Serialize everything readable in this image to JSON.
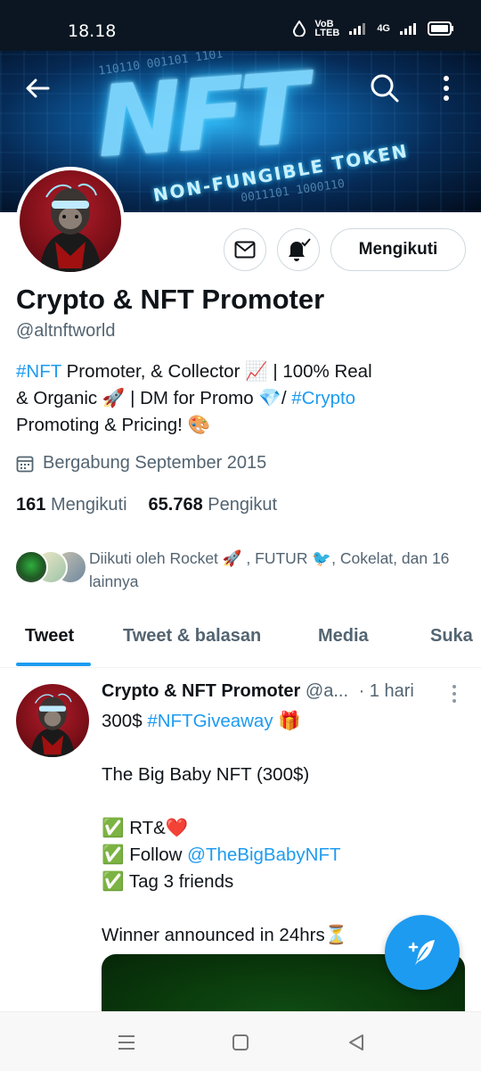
{
  "status_bar": {
    "time": "18.18",
    "network_label_top": "VoB",
    "network_label_bottom": "LTEB",
    "signal_label": "4G",
    "icons": [
      "water-drop-icon",
      "signal-icon",
      "battery-icon"
    ]
  },
  "header": {
    "banner_text": "NFT",
    "banner_subtext": "NON-FUNGIBLE TOKEN",
    "banner_binary_top": "110110 001101 1101",
    "banner_binary_bottom": "0011101 1000110",
    "back_icon": "back-arrow-icon",
    "search_icon": "search-icon",
    "more_icon": "more-vertical-icon"
  },
  "profile": {
    "name": "Crypto & NFT Promoter",
    "handle": "@altnftworld",
    "follow_button_label": "Mengikuti",
    "bio": {
      "line1_tag": "#NFT",
      "line1_text": " Promoter, & Collector 📈 | 100% Real",
      "line2_text": "& Organic 🚀 | DM for Promo 💎/ ",
      "line2_tag": "#Crypto",
      "line3_text": "Promoting & Pricing! 🎨"
    },
    "joined": "Bergabung September 2015",
    "following_count": "161",
    "following_label": "Mengikuti",
    "followers_count": "65.768",
    "followers_label": "Pengikut",
    "followed_by": "Diikuti oleh Rocket 🚀 , FUTUR 🐦, Cokelat, dan 16 lainnya"
  },
  "tabs": [
    {
      "label": "Tweet"
    },
    {
      "label": "Tweet & balasan"
    },
    {
      "label": "Media"
    },
    {
      "label": "Suka"
    }
  ],
  "tweet": {
    "author_name": "Crypto & NFT Promoter",
    "author_handle": "@a...",
    "time": "· 1 hari",
    "line1_text": "300$ ",
    "line1_tag": "#NFTGiveaway",
    "line1_emoji": " 🎁",
    "line2": "The Big Baby NFT (300$)",
    "check1": "✅ RT&❤️",
    "check2_prefix": "✅ Follow ",
    "check2_mention": "@TheBigBabyNFT",
    "check3": "✅ Tag 3 friends",
    "winner": "Winner announced in 24hrs⏳"
  },
  "colors": {
    "accent": "#1d9bf0",
    "text": "#0f1419",
    "muted": "#536471",
    "status_bar_bg": "#0b1622"
  }
}
